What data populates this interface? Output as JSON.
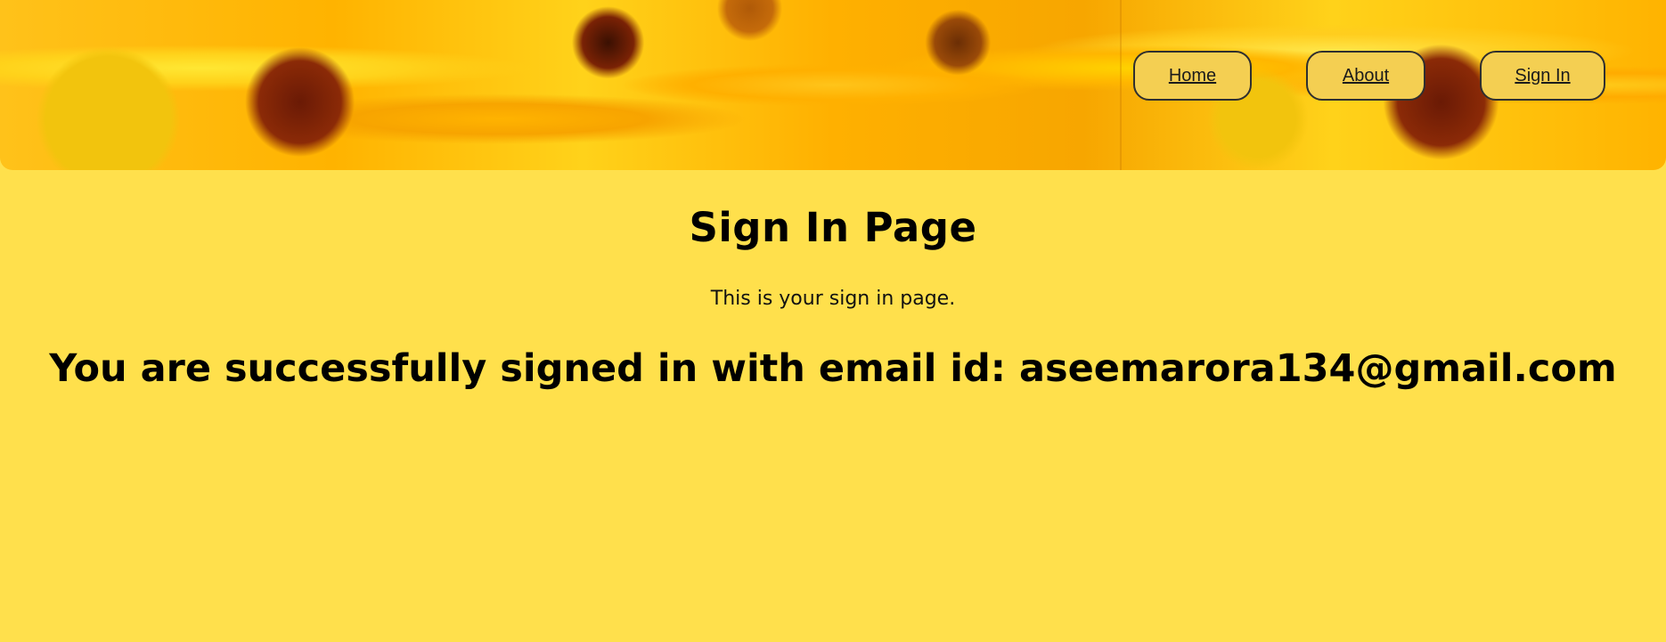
{
  "nav": {
    "home_label": "Home",
    "about_label": "About",
    "signin_label": "Sign In"
  },
  "main": {
    "title": "Sign In Page",
    "subtitle": "This is your sign in page.",
    "success_message": "You are successfully signed in with email id: aseemarora134@gmail.com"
  },
  "colors": {
    "page_background": "#ffe04c",
    "nav_button_background": "#f4cf52",
    "nav_button_border": "#2f2f2f",
    "text": "#000000"
  }
}
